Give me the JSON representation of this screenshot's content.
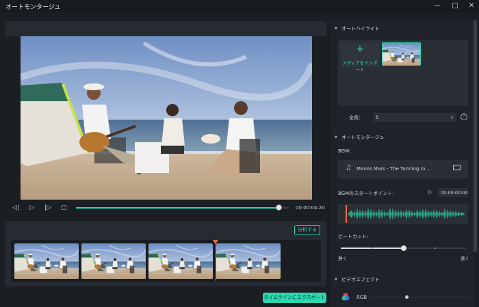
{
  "window": {
    "title": "オートモンタージュ",
    "controls": [
      "minimize-icon",
      "maximize-icon",
      "close-icon"
    ]
  },
  "player": {
    "timecode": "00:00:04:20",
    "progress": 0.95,
    "buttons": [
      "prev-frame-icon",
      "play-icon",
      "next-frame-icon",
      "stop-icon"
    ]
  },
  "timeline": {
    "analyze_label": "分析する",
    "clip_count": 4,
    "playhead_after_clip": 3,
    "export_label": "タイムラインにエクスポートする"
  },
  "highlight": {
    "section_title": "オートハイライト",
    "import_label": "メディアをインポート",
    "duration_label": "全長：",
    "duration_value": "5",
    "duration_unit": "s"
  },
  "montage": {
    "section_title": "オートモンタージュ",
    "bgm_label": "BGM:",
    "bgm_track": "Manos Mars - The Tunning.m...",
    "bgm_start_label": "BGMのスタートポイント：",
    "bgm_start_value": "00:00:00:00",
    "beat_cut_label": "ビートカット:",
    "beat_cut_level": 0.5,
    "slow_label": "遅く",
    "fast_label": "速く"
  },
  "effects": {
    "section_title": "ビデオエフェクト",
    "items": [
      {
        "name": "RGB",
        "level": 0.35
      }
    ]
  },
  "colors": {
    "accent": "#2bd8b0",
    "playhead": "#ff6a3d",
    "panel": "#1f2228",
    "background": "#1b1e23"
  }
}
